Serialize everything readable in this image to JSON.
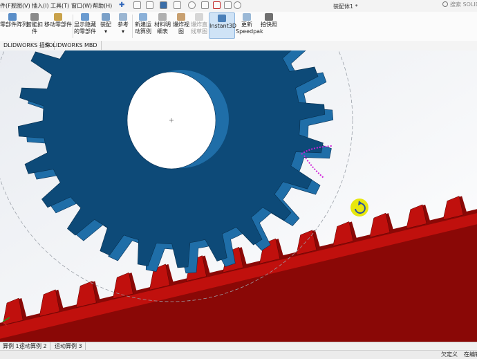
{
  "menubar": {
    "items": [
      "件(F)",
      "视图(V)",
      "插入(I)",
      "工具(T)",
      "窗口(W)",
      "帮助(H)"
    ],
    "title": "装配体1 *",
    "search_placeholder": "搜索 SOLIDWORKS"
  },
  "ribbon": {
    "buttons": [
      {
        "label1": "零部件阵列",
        "label2": "",
        "icon": "component-pattern-icon",
        "dim": false
      },
      {
        "label1": "智能扣",
        "label2": "件",
        "icon": "smart-fastener-icon",
        "dim": false
      },
      {
        "label1": "移动零部件",
        "label2": "",
        "icon": "move-component-icon",
        "dim": false
      },
      {
        "label1": "显示隐藏",
        "label2": "的零部件",
        "icon": "show-hidden-icon",
        "dim": false
      },
      {
        "label1": "装配",
        "label2": "",
        "icon": "assembly-features-icon",
        "dim": false
      },
      {
        "label1": "参考",
        "label2": "",
        "icon": "reference-geometry-icon",
        "dim": false
      },
      {
        "label1": "新建运",
        "label2": "动算例",
        "icon": "new-motion-study-icon",
        "dim": false
      },
      {
        "label1": "材料明",
        "label2": "细表",
        "icon": "bill-of-materials-icon",
        "dim": false
      },
      {
        "label1": "爆炸视",
        "label2": "图",
        "icon": "exploded-view-icon",
        "dim": false
      },
      {
        "label1": "爆炸直",
        "label2": "线草图",
        "icon": "explode-line-sketch-icon",
        "dim": true
      },
      {
        "label1": "Instant3D",
        "label2": "",
        "icon": "instant3d-icon",
        "dim": false
      },
      {
        "label1": "更新",
        "label2": "Speedpak",
        "icon": "speedpak-icon",
        "dim": false
      },
      {
        "label1": "拍快照",
        "label2": "",
        "icon": "snapshot-icon",
        "dim": false
      }
    ],
    "active": "Instant3D"
  },
  "command_tabs": [
    "DLIDWORKS 插件",
    "SOLIDWORKS MBD"
  ],
  "bottom_tabs": [
    "算例 1",
    "运动算例 2",
    "运动算例 3"
  ],
  "status": {
    "left": "欠定义",
    "right": "在编辑"
  },
  "colors": {
    "gear_face": "#0d4a78",
    "gear_side": "#1f6ea8",
    "rack_face": "#c0100d",
    "rack_side": "#8a0806",
    "rotate_indicator": "#e6e600",
    "path_sketch": "#d020d8"
  }
}
